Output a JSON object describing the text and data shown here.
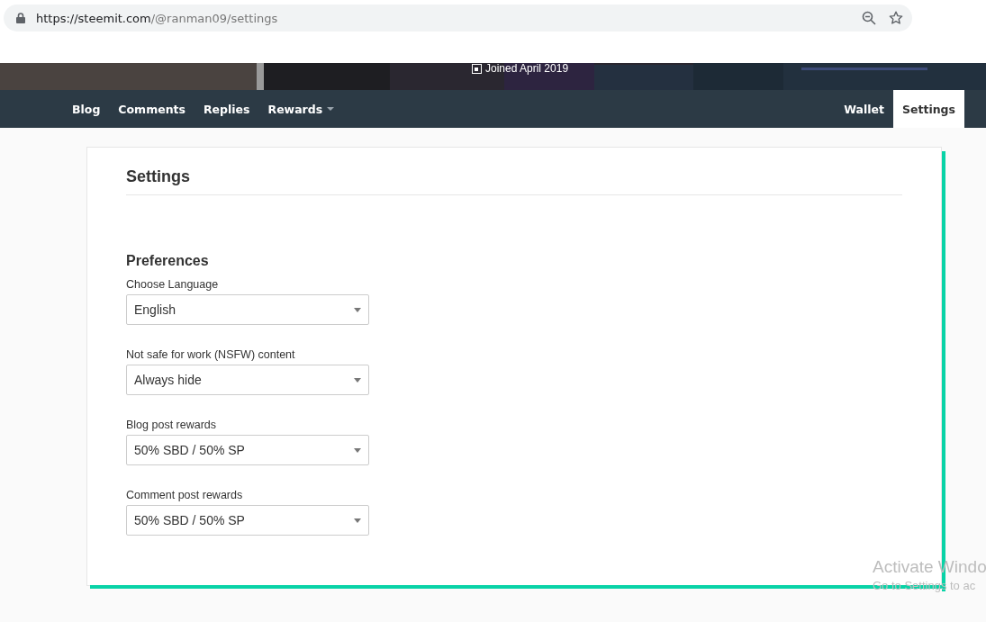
{
  "address_bar": {
    "url_host": "https://steemit.com",
    "url_path": "/@ranman09/settings"
  },
  "profile_header": {
    "joined": "Joined April 2019"
  },
  "nav": {
    "left": [
      {
        "label": "Blog",
        "selected": false,
        "dropdown": false
      },
      {
        "label": "Comments",
        "selected": false,
        "dropdown": false
      },
      {
        "label": "Replies",
        "selected": false,
        "dropdown": false
      },
      {
        "label": "Rewards",
        "selected": false,
        "dropdown": true
      }
    ],
    "right": [
      {
        "label": "Wallet",
        "selected": false,
        "dropdown": false
      },
      {
        "label": "Settings",
        "selected": true,
        "dropdown": false
      }
    ]
  },
  "settings": {
    "title": "Settings",
    "section": "Preferences",
    "fields": [
      {
        "label": "Choose Language",
        "value": "English"
      },
      {
        "label": "Not safe for work (NSFW) content",
        "value": "Always hide"
      },
      {
        "label": "Blog post rewards",
        "value": "50% SBD / 50% SP"
      },
      {
        "label": "Comment post rewards",
        "value": "50% SBD / 50% SP"
      }
    ]
  },
  "activation_notice": {
    "title": "Activate Windo",
    "subtitle": "Go to Settings to ac"
  }
}
